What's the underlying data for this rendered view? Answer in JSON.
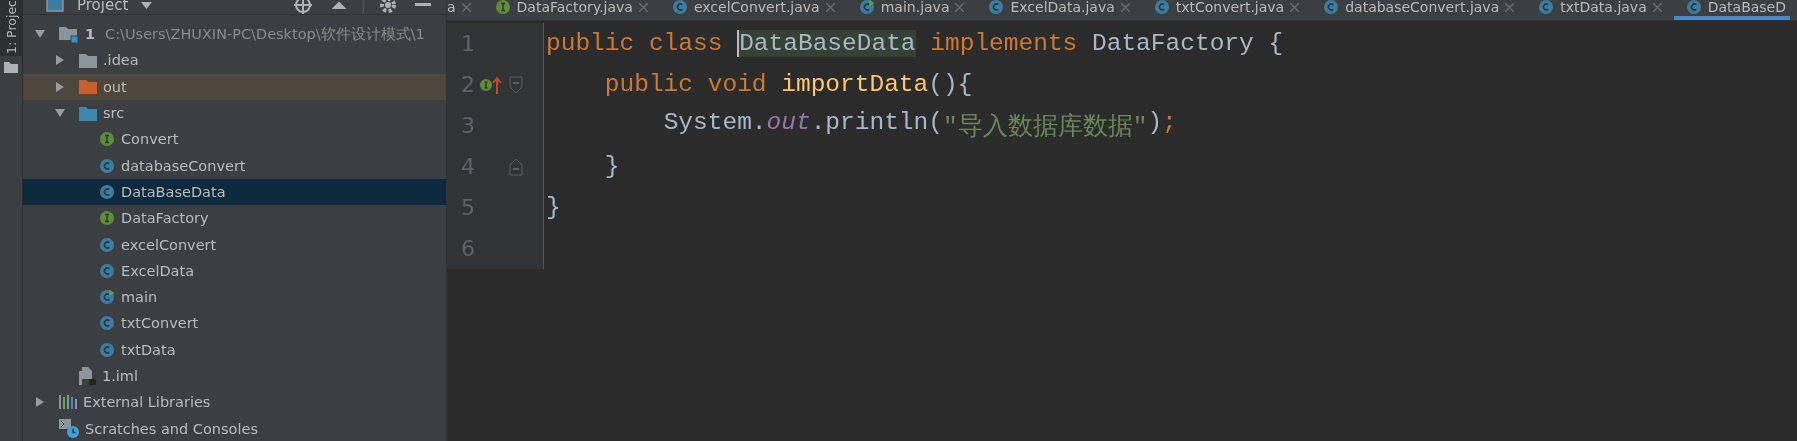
{
  "side_stripe": {
    "label": "1: Projec"
  },
  "project_panel": {
    "title": "Project",
    "tree": [
      {
        "kind": "module",
        "label": "1",
        "path": "C:\\Users\\ZHUXIN-PC\\Desktop\\软件设计模式\\1",
        "expanded": true,
        "selected": false,
        "children": [
          {
            "kind": "folder",
            "label": ".idea",
            "expanded": false,
            "selected": false
          },
          {
            "kind": "excluded-folder",
            "label": "out",
            "expanded": false,
            "selected": false
          },
          {
            "kind": "source-folder",
            "label": "src",
            "expanded": true,
            "selected": false,
            "children": [
              {
                "kind": "interface",
                "label": "Convert",
                "selected": false
              },
              {
                "kind": "class",
                "label": "databaseConvert",
                "selected": false
              },
              {
                "kind": "class",
                "label": "DataBaseData",
                "selected": true
              },
              {
                "kind": "interface",
                "label": "DataFactory",
                "selected": false
              },
              {
                "kind": "class",
                "label": "excelConvert",
                "selected": false
              },
              {
                "kind": "class",
                "label": "ExcelData",
                "selected": false
              },
              {
                "kind": "main-class",
                "label": "main",
                "selected": false
              },
              {
                "kind": "class",
                "label": "txtConvert",
                "selected": false
              },
              {
                "kind": "class",
                "label": "txtData",
                "selected": false
              }
            ]
          },
          {
            "kind": "module-file",
            "label": "1.iml",
            "selected": false
          }
        ]
      },
      {
        "kind": "libraries",
        "label": "External Libraries",
        "expanded": false,
        "selected": false
      },
      {
        "kind": "scratches",
        "label": "Scratches and Consoles",
        "selected": false
      }
    ]
  },
  "tabs": [
    {
      "kind": "cut",
      "label": "a",
      "selected": false
    },
    {
      "kind": "interface",
      "label": "DataFactory.java",
      "selected": false
    },
    {
      "kind": "class",
      "label": "excelConvert.java",
      "selected": false
    },
    {
      "kind": "main-class",
      "label": "main.java",
      "selected": false
    },
    {
      "kind": "class",
      "label": "ExcelData.java",
      "selected": false
    },
    {
      "kind": "class",
      "label": "txtConvert.java",
      "selected": false
    },
    {
      "kind": "class",
      "label": "databaseConvert.java",
      "selected": false
    },
    {
      "kind": "class",
      "label": "txtData.java",
      "selected": false
    },
    {
      "kind": "class",
      "label": "DataBaseD",
      "selected": true
    }
  ],
  "editor": {
    "lines": [
      {
        "number": "1",
        "kind": "plain",
        "tokens": [
          {
            "kind": "keyword",
            "text": "public class "
          },
          {
            "kind": "highlighted-identifier",
            "text": "DataBaseData"
          },
          {
            "kind": "keyword",
            "text": " implements "
          },
          {
            "kind": "plain",
            "text": "DataFactory {"
          }
        ]
      },
      {
        "number": "2",
        "kind": "implementing-method-start",
        "tokens": [
          {
            "kind": "keyword",
            "text": "    public void "
          },
          {
            "kind": "method",
            "text": "importData"
          },
          {
            "kind": "plain",
            "text": "(){"
          }
        ]
      },
      {
        "number": "3",
        "kind": "plain",
        "tokens": [
          {
            "kind": "plain",
            "text": "        System."
          },
          {
            "kind": "static-field",
            "text": "out"
          },
          {
            "kind": "plain",
            "text": ".println("
          },
          {
            "kind": "string",
            "text": "\"导入数据库数据\""
          },
          {
            "kind": "plain",
            "text": ")"
          },
          {
            "kind": "keyword",
            "text": ";"
          }
        ]
      },
      {
        "number": "4",
        "kind": "block-end",
        "tokens": [
          {
            "kind": "plain",
            "text": "    }"
          }
        ]
      },
      {
        "number": "5",
        "kind": "plain",
        "tokens": [
          {
            "kind": "plain",
            "text": "}"
          }
        ]
      },
      {
        "number": "6",
        "kind": "plain"
      }
    ]
  }
}
